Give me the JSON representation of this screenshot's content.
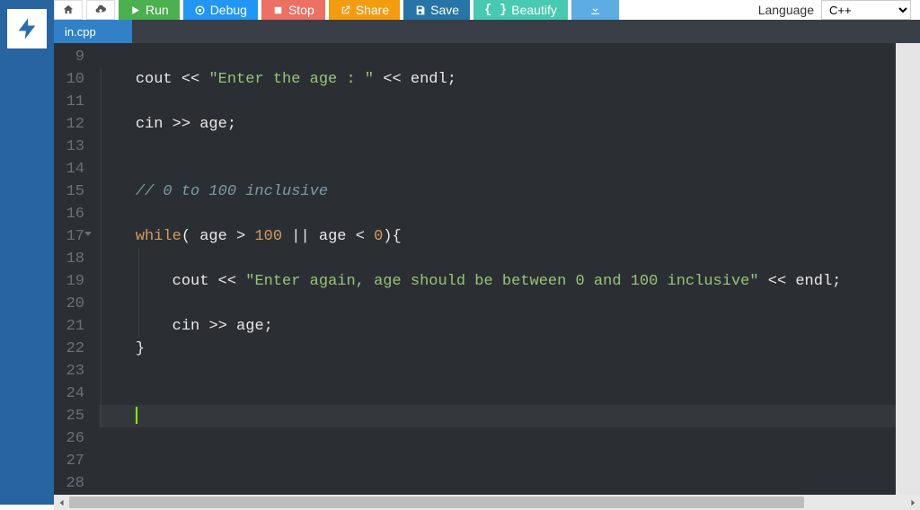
{
  "toolbar": {
    "run": "Run",
    "debug": "Debug",
    "stop": "Stop",
    "share": "Share",
    "save": "Save",
    "beautify": "Beautify"
  },
  "language": {
    "label": "Language",
    "value": "C++"
  },
  "tab": {
    "filename": "in.cpp"
  },
  "gutter": {
    "start": 9,
    "end": 28,
    "fold_line": 17,
    "active_line": 25
  },
  "code": {
    "lines": [
      {
        "n": 9,
        "indent": 0,
        "tokens": []
      },
      {
        "n": 10,
        "indent": 1,
        "tokens": [
          {
            "t": "cout ",
            "c": "id"
          },
          {
            "t": "<< ",
            "c": "op"
          },
          {
            "t": "\"Enter the age : \"",
            "c": "str"
          },
          {
            "t": " << ",
            "c": "op"
          },
          {
            "t": "endl",
            "c": "id"
          },
          {
            "t": ";",
            "c": "punc"
          }
        ]
      },
      {
        "n": 11,
        "indent": 1,
        "tokens": []
      },
      {
        "n": 12,
        "indent": 1,
        "tokens": [
          {
            "t": "cin ",
            "c": "id"
          },
          {
            "t": ">> ",
            "c": "op"
          },
          {
            "t": "age",
            "c": "id"
          },
          {
            "t": ";",
            "c": "punc"
          }
        ]
      },
      {
        "n": 13,
        "indent": 1,
        "tokens": []
      },
      {
        "n": 14,
        "indent": 1,
        "tokens": []
      },
      {
        "n": 15,
        "indent": 1,
        "tokens": [
          {
            "t": "// 0 to 100 inclusive",
            "c": "cmt"
          }
        ]
      },
      {
        "n": 16,
        "indent": 1,
        "tokens": []
      },
      {
        "n": 17,
        "indent": 1,
        "tokens": [
          {
            "t": "while",
            "c": "kw"
          },
          {
            "t": "( age ",
            "c": "id"
          },
          {
            "t": "> ",
            "c": "op"
          },
          {
            "t": "100",
            "c": "num"
          },
          {
            "t": " || ",
            "c": "op"
          },
          {
            "t": "age ",
            "c": "id"
          },
          {
            "t": "< ",
            "c": "op"
          },
          {
            "t": "0",
            "c": "num"
          },
          {
            "t": "){",
            "c": "punc"
          }
        ]
      },
      {
        "n": 18,
        "indent": 2,
        "tokens": []
      },
      {
        "n": 19,
        "indent": 2,
        "tokens": [
          {
            "t": "cout ",
            "c": "id"
          },
          {
            "t": "<< ",
            "c": "op"
          },
          {
            "t": "\"Enter again, age should be between 0 and 100 inclusive\"",
            "c": "str"
          },
          {
            "t": " << ",
            "c": "op"
          },
          {
            "t": "endl",
            "c": "id"
          },
          {
            "t": ";",
            "c": "punc"
          }
        ]
      },
      {
        "n": 20,
        "indent": 2,
        "tokens": []
      },
      {
        "n": 21,
        "indent": 2,
        "tokens": [
          {
            "t": "cin ",
            "c": "id"
          },
          {
            "t": ">> ",
            "c": "op"
          },
          {
            "t": "age",
            "c": "id"
          },
          {
            "t": ";",
            "c": "punc"
          }
        ]
      },
      {
        "n": 22,
        "indent": 1,
        "tokens": [
          {
            "t": "}",
            "c": "punc"
          }
        ]
      },
      {
        "n": 23,
        "indent": 1,
        "tokens": []
      },
      {
        "n": 24,
        "indent": 1,
        "tokens": []
      },
      {
        "n": 25,
        "indent": 1,
        "tokens": [],
        "cursor": true
      },
      {
        "n": 26,
        "indent": 0,
        "tokens": []
      },
      {
        "n": 27,
        "indent": 0,
        "tokens": []
      },
      {
        "n": 28,
        "indent": 0,
        "tokens": []
      }
    ]
  }
}
